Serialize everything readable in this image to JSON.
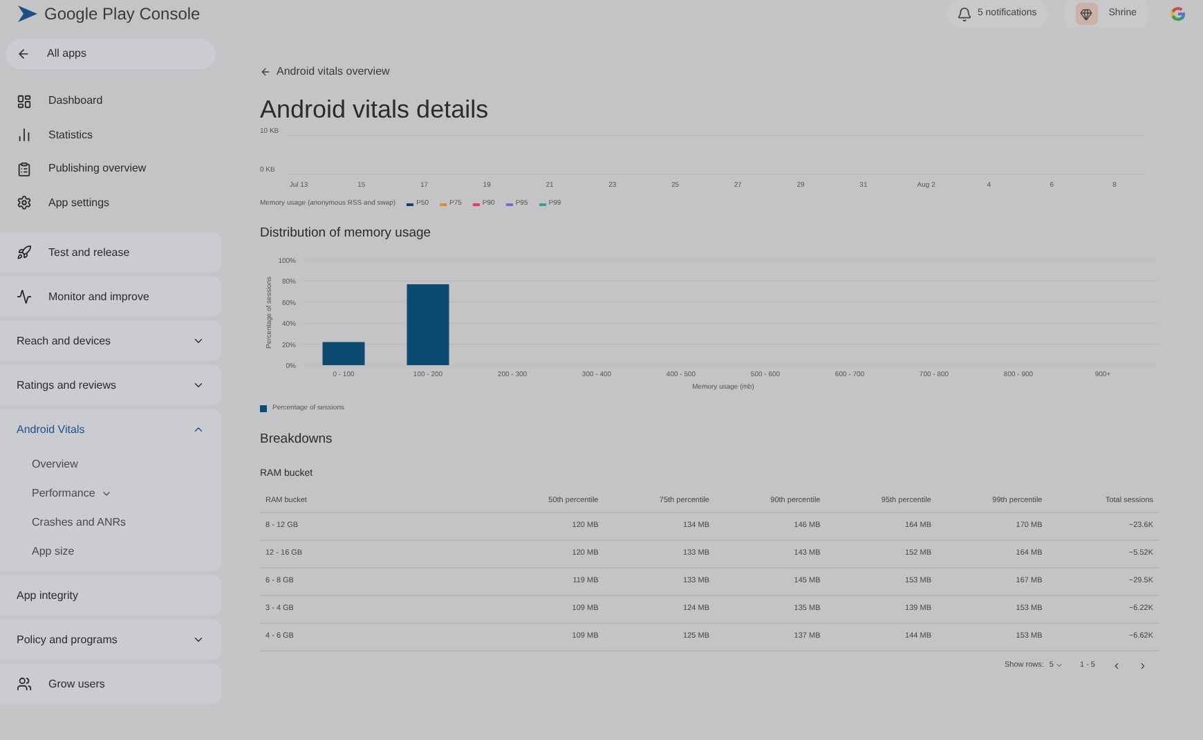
{
  "header": {
    "logo_text": "Google Play Console",
    "notifications": "5 notifications",
    "user": "Shrine"
  },
  "sidebar": {
    "back": "All apps",
    "top_items": [
      "Dashboard",
      "Statistics",
      "Publishing overview",
      "App settings"
    ],
    "groups": [
      {
        "label": "Test and release",
        "kind": "link",
        "selected": false
      },
      {
        "label": "Monitor and improve",
        "kind": "link",
        "selected": false
      },
      {
        "label": "Reach and devices",
        "kind": "collapsible",
        "expanded": false,
        "selected": false
      },
      {
        "label": "Ratings and reviews",
        "kind": "collapsible",
        "expanded": false,
        "selected": false
      },
      {
        "label": "Android Vitals",
        "kind": "collapsible",
        "expanded": true,
        "selected": true,
        "children": [
          {
            "label": "Overview",
            "dropdown": false
          },
          {
            "label": "Performance",
            "dropdown": true
          },
          {
            "label": "Crashes and ANRs",
            "dropdown": false
          },
          {
            "label": "App size",
            "dropdown": false
          }
        ]
      },
      {
        "label": "App integrity",
        "kind": "link",
        "selected": false
      },
      {
        "label": "Policy and programs",
        "kind": "collapsible",
        "expanded": false,
        "selected": false
      },
      {
        "label": "Grow users",
        "kind": "link",
        "selected": false
      }
    ]
  },
  "breadcrumb": "Android vitals overview",
  "title": "Android vitals details",
  "usage_chart": {
    "chart_data": {
      "type": "line",
      "ylabel": "Memory usage (anonymous RSS and swap)",
      "x": [
        "Jul 13",
        "15",
        "17",
        "19",
        "21",
        "23",
        "25",
        "27",
        "29",
        "31",
        "Aug 2",
        "4",
        "6",
        "8"
      ],
      "yticks": [
        {
          "value": 0,
          "label": "0 KB"
        },
        {
          "value": 10,
          "label": "10 KB"
        }
      ],
      "ylim": [
        0,
        10
      ],
      "series": [
        {
          "name": "P50",
          "color": "#1a3d66",
          "values": [
            null,
            null,
            null,
            null,
            null,
            null,
            null,
            null,
            null,
            null,
            null,
            null,
            null,
            null
          ]
        },
        {
          "name": "P75",
          "color": "#e08a3c",
          "values": [
            null,
            null,
            null,
            null,
            null,
            null,
            null,
            null,
            null,
            null,
            null,
            null,
            null,
            null
          ]
        },
        {
          "name": "P90",
          "color": "#d9455f",
          "values": [
            null,
            null,
            null,
            null,
            null,
            null,
            null,
            null,
            null,
            null,
            null,
            null,
            null,
            null
          ]
        },
        {
          "name": "P95",
          "color": "#6a6fc9",
          "values": [
            null,
            null,
            null,
            null,
            null,
            null,
            null,
            null,
            null,
            null,
            null,
            null,
            null,
            null
          ]
        },
        {
          "name": "P99",
          "color": "#3aa38a",
          "values": [
            null,
            null,
            null,
            null,
            null,
            null,
            null,
            null,
            null,
            null,
            null,
            null,
            null,
            null
          ]
        }
      ],
      "legend": "bottom"
    }
  },
  "distribution": {
    "title": "Distribution of memory usage",
    "chart_data": {
      "type": "bar",
      "xlabel": "Memory usage (mb)",
      "ylabel": "Percentage of sessions",
      "categories": [
        "0 - 100",
        "100 - 200",
        "200 - 300",
        "300 - 400",
        "400 - 500",
        "500 - 600",
        "600 - 700",
        "700 - 800",
        "800 - 900",
        "900+"
      ],
      "ylim": [
        0,
        100
      ],
      "yticks": [
        {
          "value": 0,
          "label": "0%"
        },
        {
          "value": 20,
          "label": "20%"
        },
        {
          "value": 40,
          "label": "40%"
        },
        {
          "value": 60,
          "label": "60%"
        },
        {
          "value": 80,
          "label": "80%"
        },
        {
          "value": 100,
          "label": "100%"
        }
      ],
      "series": [
        {
          "name": "Percentage of sessions",
          "color": "#0d4a72",
          "values": [
            22,
            77,
            0,
            0,
            0,
            0,
            0,
            0,
            0,
            0
          ]
        }
      ],
      "legend": "bottom",
      "grid": true
    }
  },
  "breakdowns": {
    "title": "Breakdowns",
    "subtitle": "RAM bucket",
    "columns": [
      "RAM bucket",
      "50th percentile",
      "75th percentile",
      "90th percentile",
      "95th percentile",
      "99th percentile",
      "Total sessions"
    ],
    "rows": [
      [
        "8 - 12 GB",
        "120 MB",
        "134 MB",
        "146 MB",
        "164 MB",
        "170 MB",
        "~23.6K"
      ],
      [
        "12 - 16 GB",
        "120 MB",
        "133 MB",
        "143 MB",
        "152 MB",
        "164 MB",
        "~5.52K"
      ],
      [
        "6 - 8 GB",
        "119 MB",
        "133 MB",
        "145 MB",
        "153 MB",
        "167 MB",
        "~29.5K"
      ],
      [
        "3 - 4 GB",
        "109 MB",
        "124 MB",
        "135 MB",
        "139 MB",
        "153 MB",
        "~6.22K"
      ],
      [
        "4 - 6 GB",
        "109 MB",
        "125 MB",
        "137 MB",
        "144 MB",
        "153 MB",
        "~6.62K"
      ]
    ],
    "footer": {
      "rows_label": "Show rows:",
      "rows_value": "5",
      "range": "1 - 5"
    }
  }
}
